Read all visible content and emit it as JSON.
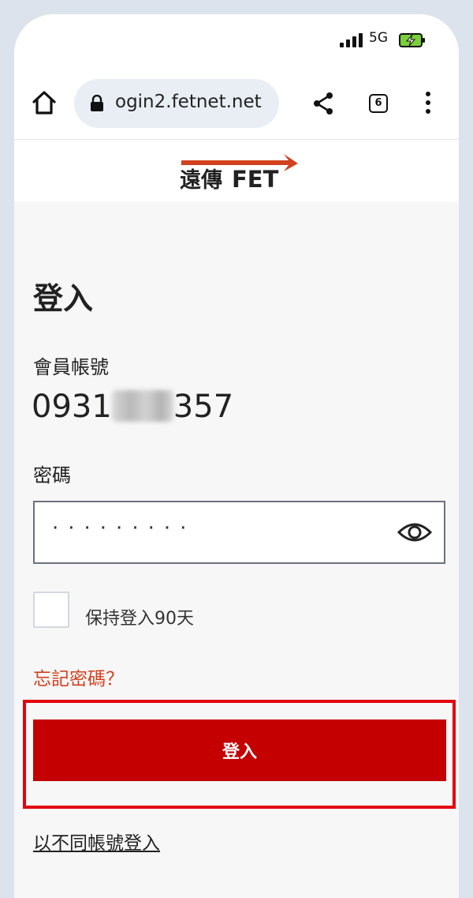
{
  "status_bar": {
    "network": "5G"
  },
  "browser": {
    "url": "ogin2.fetnet.net",
    "tab_count": "6"
  },
  "brand": {
    "logo_text_cn": "遠傳",
    "logo_text_en": "FET",
    "accent": "#c40000",
    "logo_red": "#d1411e"
  },
  "login": {
    "title": "登入",
    "account_label": "會員帳號",
    "account_prefix": "0931",
    "account_suffix": "357",
    "password_label": "密碼",
    "password_mask": "·········",
    "keep_logged_in_label": "保持登入90天",
    "forgot_password": "忘記密碼？",
    "login_button": "登入",
    "other_account_link": "以不同帳號登入"
  }
}
